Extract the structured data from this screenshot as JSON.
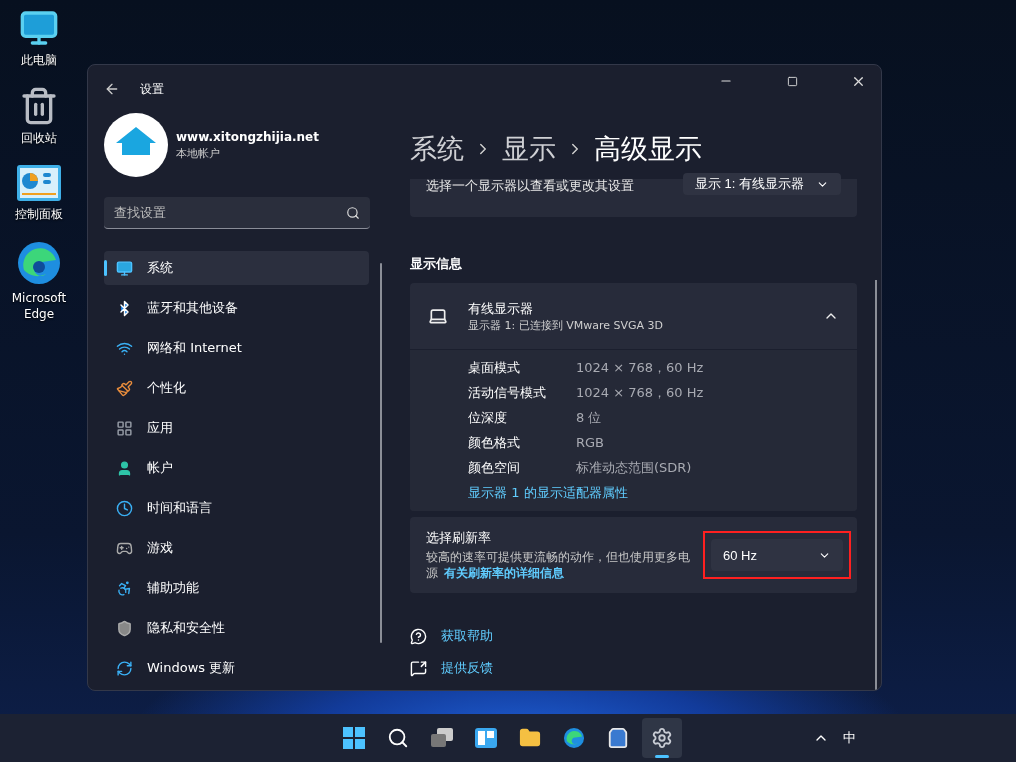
{
  "desktop_icons": [
    {
      "label": "此电脑",
      "kind": "computer"
    },
    {
      "label": "回收站",
      "kind": "recycle"
    },
    {
      "label": "控制面板",
      "kind": "control"
    },
    {
      "label": "Microsoft Edge",
      "kind": "edge"
    }
  ],
  "window": {
    "title": "设置",
    "account": {
      "name": "www.xitongzhijia.net",
      "type": "本地帐户"
    },
    "search": {
      "placeholder": "查找设置"
    },
    "nav": [
      {
        "label": "系统",
        "kind": "system",
        "selected": true
      },
      {
        "label": "蓝牙和其他设备",
        "kind": "bluetooth",
        "selected": false
      },
      {
        "label": "网络和 Internet",
        "kind": "network",
        "selected": false
      },
      {
        "label": "个性化",
        "kind": "personalize",
        "selected": false
      },
      {
        "label": "应用",
        "kind": "apps",
        "selected": false
      },
      {
        "label": "帐户",
        "kind": "accounts",
        "selected": false
      },
      {
        "label": "时间和语言",
        "kind": "time",
        "selected": false
      },
      {
        "label": "游戏",
        "kind": "gaming",
        "selected": false
      },
      {
        "label": "辅助功能",
        "kind": "accessibility",
        "selected": false
      },
      {
        "label": "隐私和安全性",
        "kind": "privacy",
        "selected": false
      },
      {
        "label": "Windows 更新",
        "kind": "update",
        "selected": false
      }
    ],
    "breadcrumb": [
      "系统",
      "显示",
      "高级显示"
    ],
    "display_select": {
      "label": "选择一个显示器以查看或更改其设置",
      "value": "显示 1: 有线显示器"
    },
    "section_title": "显示信息",
    "display_card": {
      "title": "有线显示器",
      "subtitle": "显示器 1: 已连接到 VMware SVGA 3D",
      "expanded": true,
      "rows": [
        {
          "label": "桌面模式",
          "value": "1024 × 768，60 Hz"
        },
        {
          "label": "活动信号模式",
          "value": "1024 × 768，60 Hz"
        },
        {
          "label": "位深度",
          "value": "8 位"
        },
        {
          "label": "颜色格式",
          "value": "RGB"
        },
        {
          "label": "颜色空间",
          "value": "标准动态范围(SDR)"
        }
      ],
      "link": "显示器 1 的显示适配器属性"
    },
    "refresh": {
      "title": "选择刷新率",
      "description": "较高的速率可提供更流畅的动作，但也使用更多电源",
      "link": "有关刷新率的详细信息",
      "value": "60 Hz",
      "highlighted": true
    },
    "help_links": [
      {
        "label": "获取帮助",
        "kind": "help"
      },
      {
        "label": "提供反馈",
        "kind": "feedback"
      }
    ]
  },
  "taskbar": {
    "apps": [
      {
        "kind": "start",
        "selected": false
      },
      {
        "kind": "search",
        "selected": false
      },
      {
        "kind": "taskview",
        "selected": false
      },
      {
        "kind": "widgets",
        "selected": false
      },
      {
        "kind": "explorer",
        "selected": false
      },
      {
        "kind": "edge",
        "selected": false
      },
      {
        "kind": "store",
        "selected": false
      },
      {
        "kind": "settings",
        "selected": true
      }
    ],
    "ime": "中"
  }
}
